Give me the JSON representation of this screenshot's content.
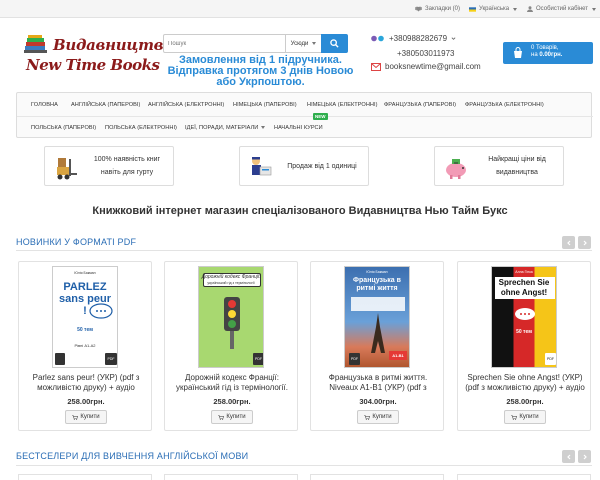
{
  "topbar": {
    "compare_label": "",
    "bookmarks_label": "Закладки (0)",
    "language_label": "Українська",
    "account_label": "Особистий кабінет"
  },
  "logo": {
    "line1": "Видавництво",
    "line2": "New Time Books"
  },
  "search": {
    "placeholder": "Пошук",
    "category": "Усюди"
  },
  "promo": {
    "text": "Замовлення від 1 підручника. Відправка протягом 3 днів Новою або Укрпоштою."
  },
  "contacts": {
    "phone1": "+380988282679",
    "phone2": "+380503011973",
    "email": "booksnewtime@gmail.com"
  },
  "cart": {
    "line1": "0 Товарів,",
    "line2_prefix": "на ",
    "amount": "0.00грн."
  },
  "nav": {
    "items": [
      "Головна",
      "Англійська (паперові)",
      "Англійська (електронні)",
      "Німецька (паперові)",
      "Німецька (електронні)",
      "Французька (паперові)",
      "Французька (електронні)",
      "Польська (паперові)",
      "Польська (електронні)",
      "Ідеї, поради, матеріали",
      "Начальні курси"
    ],
    "new_badge": "NEW"
  },
  "features": [
    {
      "text": "100% наявність книг навіть для гурту",
      "icon": "forklift-icon"
    },
    {
      "text": "Продаж від 1 одиниці",
      "icon": "courier-icon"
    },
    {
      "text": "Найкращі ціни від видавництва",
      "icon": "piggy-bank-icon"
    }
  ],
  "headline": "Книжковий інтернет магазин спеціалізованого Видавництва Нью Тайм Букс",
  "sections": {
    "new_pdf": "Новинки у форматі PDF",
    "bestsellers": "Бестселери для вивчення англійської мови"
  },
  "products": [
    {
      "name": "Parlez sans peur! (УКР) (pdf з можливістю друку) + аудіо",
      "price": "258.00грн.",
      "buy": "Купити",
      "cover_author": "Юлія Бакман",
      "cover_title": "PARLEZ sans peur !",
      "cover_sub": "50 тем",
      "cover_level": "Рівні A1-A2",
      "cover_badge": "PDF"
    },
    {
      "name": "Дорожній кодекс Франції: український гід із термінології.",
      "price": "258.00грн.",
      "buy": "Купити",
      "cover_title": "Дорожній кодекс Франції:",
      "cover_sub": "український гід з термінології",
      "cover_badge": "PDF"
    },
    {
      "name": "Французька в ритмі життя. Niveaux A1-B1 (УКР) (pdf з",
      "price": "304.00грн.",
      "buy": "Купити",
      "cover_author": "Юлія Бакман",
      "cover_title": "Французька в ритмі життя",
      "cover_level": "A1-B1",
      "cover_badge": "PDF"
    },
    {
      "name": "Sprechen Sie ohne Angst! (УКР) (pdf з можливістю друку) + аудіо",
      "price": "258.00грн.",
      "buy": "Купити",
      "cover_author": "Алла Гінка",
      "cover_title": "Sprechen Sie ohne Angst!",
      "cover_sub": "50 тем",
      "cover_badge": "PDF"
    }
  ],
  "colors": {
    "accent": "#2a8bd6",
    "logo": "#8b1a1a",
    "section_title": "#2a6db5",
    "new_badge": "#2eae4d"
  }
}
